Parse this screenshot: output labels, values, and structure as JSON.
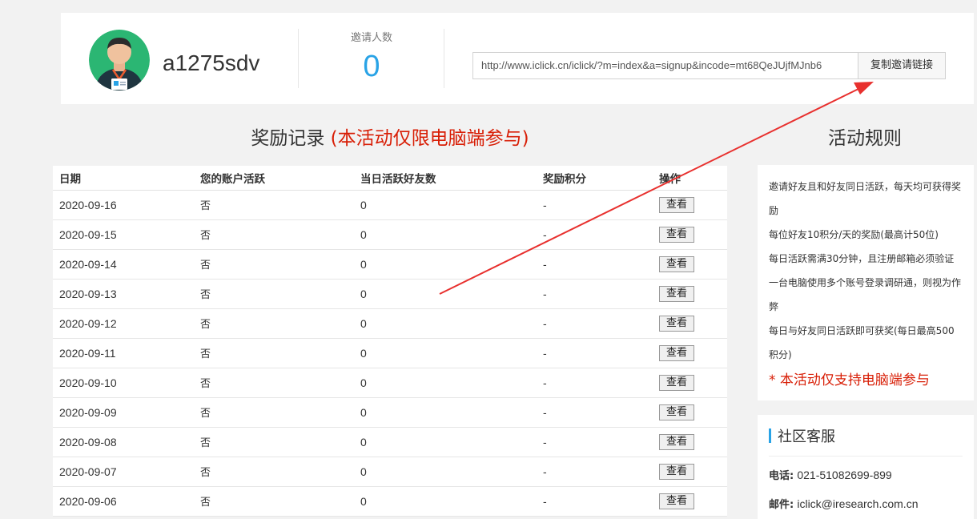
{
  "user": {
    "username": "a1275sdv"
  },
  "invite": {
    "label": "邀请人数",
    "count": "0",
    "link": "http://www.iclick.cn/iclick/?m=index&a=signup&incode=mt68QeJUjfMJnb6",
    "copy_label": "复制邀请链接"
  },
  "rewards": {
    "title": "奖励记录",
    "note": "(本活动仅限电脑端参与)",
    "columns": [
      "日期",
      "您的账户活跃",
      "当日活跃好友数",
      "奖励积分",
      "操作"
    ],
    "view_label": "查看",
    "rows": [
      {
        "date": "2020-09-16",
        "active": "否",
        "friends": "0",
        "points": "-"
      },
      {
        "date": "2020-09-15",
        "active": "否",
        "friends": "0",
        "points": "-"
      },
      {
        "date": "2020-09-14",
        "active": "否",
        "friends": "0",
        "points": "-"
      },
      {
        "date": "2020-09-13",
        "active": "否",
        "friends": "0",
        "points": "-"
      },
      {
        "date": "2020-09-12",
        "active": "否",
        "friends": "0",
        "points": "-"
      },
      {
        "date": "2020-09-11",
        "active": "否",
        "friends": "0",
        "points": "-"
      },
      {
        "date": "2020-09-10",
        "active": "否",
        "friends": "0",
        "points": "-"
      },
      {
        "date": "2020-09-09",
        "active": "否",
        "friends": "0",
        "points": "-"
      },
      {
        "date": "2020-09-08",
        "active": "否",
        "friends": "0",
        "points": "-"
      },
      {
        "date": "2020-09-07",
        "active": "否",
        "friends": "0",
        "points": "-"
      },
      {
        "date": "2020-09-06",
        "active": "否",
        "friends": "0",
        "points": "-"
      }
    ]
  },
  "rules": {
    "title": "活动规则",
    "lines": [
      "邀请好友且和好友同日活跃，每天均可获得奖",
      "励",
      "每位好友10积分/天的奖励(最高计50位)",
      "每日活跃需满30分钟，且注册邮箱必须验证",
      "一台电脑使用多个账号登录调研通，则视为作",
      "弊",
      "每日与好友同日活跃即可获奖(每日最高500",
      "积分)"
    ],
    "warning": "* 本活动仅支持电脑端参与"
  },
  "service": {
    "title": "社区客服",
    "phone_label": "电话:",
    "phone": "021-51082699-899",
    "email_label": "邮件:",
    "email": "iclick@iresearch.com.cn"
  },
  "colors": {
    "accent": "#29a3e6",
    "warning": "#d81e06",
    "annotation_arrow": "#e8302e"
  }
}
